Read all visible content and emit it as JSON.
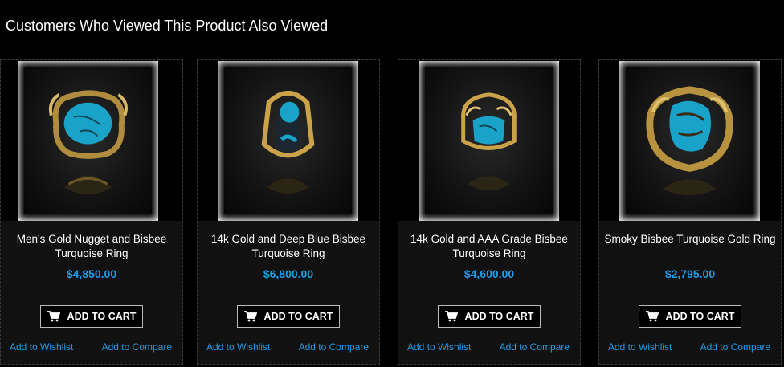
{
  "section": {
    "title": "Customers Who Viewed This Product Also Viewed"
  },
  "products": [
    {
      "name": "Men's Gold Nugget and Bisbee Turquoise Ring",
      "price": "$4,850.00",
      "add_to_cart": "ADD TO CART",
      "wishlist": "Add to Wishlist",
      "compare": "Add to Compare"
    },
    {
      "name": "14k Gold and Deep Blue Bisbee Turquoise Ring",
      "price": "$6,800.00",
      "add_to_cart": "ADD TO CART",
      "wishlist": "Add to Wishlist",
      "compare": "Add to Compare"
    },
    {
      "name": "14k Gold and AAA Grade Bisbee Turquoise Ring",
      "price": "$4,600.00",
      "add_to_cart": "ADD TO CART",
      "wishlist": "Add to Wishlist",
      "compare": "Add to Compare"
    },
    {
      "name": "Smoky Bisbee Turquoise Gold Ring",
      "price": "$2,795.00",
      "add_to_cart": "ADD TO CART",
      "wishlist": "Add to Wishlist",
      "compare": "Add to Compare"
    }
  ],
  "colors": {
    "background": "#000000",
    "card": "#111111",
    "accent": "#1e9be8",
    "turquoise": "#1aa3c9",
    "gold": "#c9a24a"
  },
  "icons": {
    "cart": "shopping-cart-icon"
  }
}
